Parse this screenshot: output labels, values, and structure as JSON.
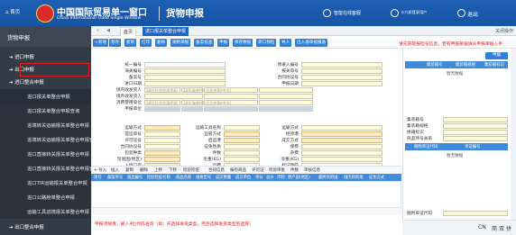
{
  "header": {
    "home": "首页",
    "title_cn": "中国国际贸易单一窗口",
    "title_en": "China International Trade Single Window",
    "module": "货物申报",
    "smart": "智能在线客服",
    "user": "卡介质登录用户",
    "logout": "退出"
  },
  "sidebar": {
    "title": "货物申报",
    "groups": [
      "进口申报",
      "出口申报",
      "进口整合申报"
    ],
    "sub_items": [
      "进口报关单整合申报",
      "进口报关单整合申报查询",
      "进境转关运输报关单整合申报",
      "进境转关运输报关单整合申报查询",
      "进口直接转关报关单整合申报",
      "进口直接转关报关单整合申报查询",
      "进口TIR运输报关单整合申报",
      "进口公路舱单整合申报",
      "运输工具进境报关单整合申报"
    ],
    "last_group": "出口整合申报"
  },
  "tabs": {
    "home": "首页",
    "active": "进口报关单整合申报",
    "right": "关闭操作"
  },
  "toolbar": {
    "buttons": [
      "+新增",
      "暂存",
      "复制",
      "打印",
      "删除",
      "随附单据",
      "备案核查",
      "申报",
      "保存数据",
      "转口预检",
      "导入",
      "出入境单据报备"
    ],
    "notice": "请先获取报检号信息，若有申报单据请从申报单据入手"
  },
  "form": {
    "labels_left": [
      "统一编号",
      "海关编号",
      "备案号",
      "进口日期",
      "境内收发货人",
      "境外收发货人",
      "消费使用单位",
      "申报单位",
      "运输方式",
      "提运单号",
      "许可证号",
      "合同协议号",
      "包装种类",
      "贸易国(地区)",
      "入境口岸",
      "特殊关系确认",
      "报关单类型"
    ],
    "labels_mid": [
      "预录入编号",
      "报关单号",
      "合同协议号",
      "申报日期",
      "运输工具名称",
      "监管方式",
      "启运港",
      "征免性质",
      "件数",
      "毛重(KG)",
      "运费",
      "价格影响确认",
      "备注"
    ],
    "labels_right": [
      "运输方式",
      "经停港",
      "成交方式",
      "保费",
      "杂费",
      "净重(KG)",
      "标记唛码",
      "集装箱号",
      "自报自缴"
    ],
    "placeholders": [
      "18位社会信用代码",
      "10位海关代码",
      "企业名称(中文)"
    ],
    "buttons": [
      "其他事项确认",
      "业务事项"
    ]
  },
  "goods": {
    "bar": [
      "+ 导入",
      "插入",
      "复制",
      "删除",
      "上移",
      "下移",
      "检验检疫",
      "合同信息",
      "报检商品",
      "许可证",
      "检验审批",
      "件数",
      "审核信息"
    ],
    "headers": [
      "项号",
      "备案序号",
      "商品编号",
      "检验检疫名称",
      "商品名称",
      "规格型号",
      "成交数量",
      "成交单位",
      "单价",
      "总价",
      "币制",
      "原产国(地区)",
      "最终目的国",
      "境内目的地",
      "征免方式"
    ],
    "note": "申报须接受，输入4位代码查询（如：先选择发货类型，然后选择发货类型后选择）"
  },
  "right_panel": {
    "button": "申报",
    "head1": [
      "集装箱号",
      "集装箱规格",
      "集装箱标识"
    ],
    "empty": "暂无数据",
    "fields": [
      "集装箱号",
      "集装箱规格",
      "拼箱标识",
      "商品项号关系"
    ],
    "head2": [
      "随附单证代码",
      "单证编号"
    ],
    "empty2": "暂无数据",
    "bottom_label": "随附单证代码"
  },
  "status": {
    "lang": "CN",
    "items": [
      "简",
      "双",
      "拼"
    ]
  }
}
